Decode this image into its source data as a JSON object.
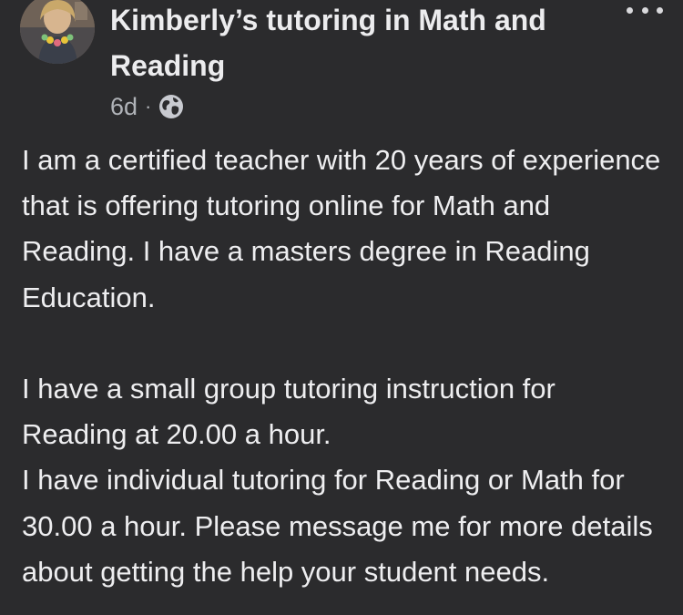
{
  "post": {
    "author_title": "Kimberly’s tutoring in Math and Reading",
    "timestamp": "6d",
    "separator": "·",
    "audience_icon": "globe-icon",
    "more_icon": "more-options-icon",
    "paragraphs": [
      "I am a certified teacher with 20 years of experience that is offering tutoring online for Math and Reading. I have a masters degree in Reading Education.",
      "I have a small group tutoring instruction for Reading at 20.00 a hour.",
      "I have individual tutoring for Reading or Math for 30.00 a hour. Please message me for more details about getting the help your student needs."
    ]
  },
  "colors": {
    "background": "#2b2b2d",
    "text": "#e4e6eb",
    "secondary_text": "#b0b3b8"
  }
}
